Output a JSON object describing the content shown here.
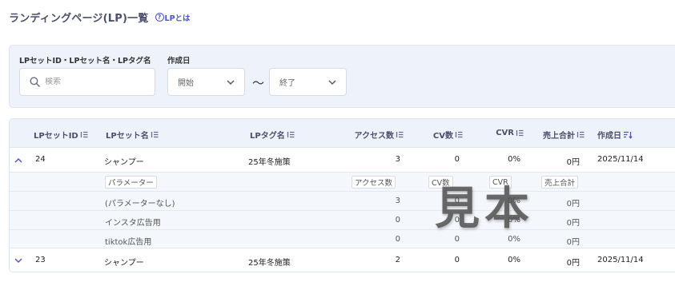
{
  "header": {
    "title": "ランディングページ(LP)一覧",
    "help_label": "LPとは",
    "help_glyph": "?"
  },
  "filters": {
    "search_label": "LPセットID・LPセット名・LPタグ名",
    "search_placeholder": "検索",
    "date_label": "作成日",
    "start_placeholder": "開始",
    "end_placeholder": "終了",
    "separator": "〜"
  },
  "table": {
    "columns": [
      "LPセットID",
      "LPセット名",
      "LPタグ名",
      "アクセス数",
      "CV数",
      "CVR",
      "売上合計",
      "作成日"
    ],
    "rows": [
      {
        "id": "24",
        "name": "シャンプー",
        "tag": "25年冬施策",
        "access": "3",
        "cv": "0",
        "cvr": "0%",
        "sales": "0円",
        "created": "2025/11/14",
        "expanded": true,
        "sub_headers": [
          "パラメーター",
          "アクセス数",
          "CV数",
          "CVR",
          "売上合計"
        ],
        "params": [
          {
            "name": "(パラメーターなし)",
            "access": "3",
            "cv": "0",
            "cvr": "0%",
            "sales": "0円"
          },
          {
            "name": "インスタ広告用",
            "access": "0",
            "cv": "0",
            "cvr": "0%",
            "sales": "0円"
          },
          {
            "name": "tiktok広告用",
            "access": "0",
            "cv": "0",
            "cvr": "0%",
            "sales": "0円"
          }
        ]
      },
      {
        "id": "23",
        "name": "シャンプー",
        "tag": "25年冬施策",
        "access": "2",
        "cv": "0",
        "cvr": "0%",
        "sales": "0円",
        "created": "2025/11/14",
        "expanded": false
      }
    ]
  },
  "watermark": "見本",
  "colors": {
    "accent": "#4b55b9",
    "header_bg": "#eef2fa",
    "heading_text": "#4a4f6a"
  }
}
